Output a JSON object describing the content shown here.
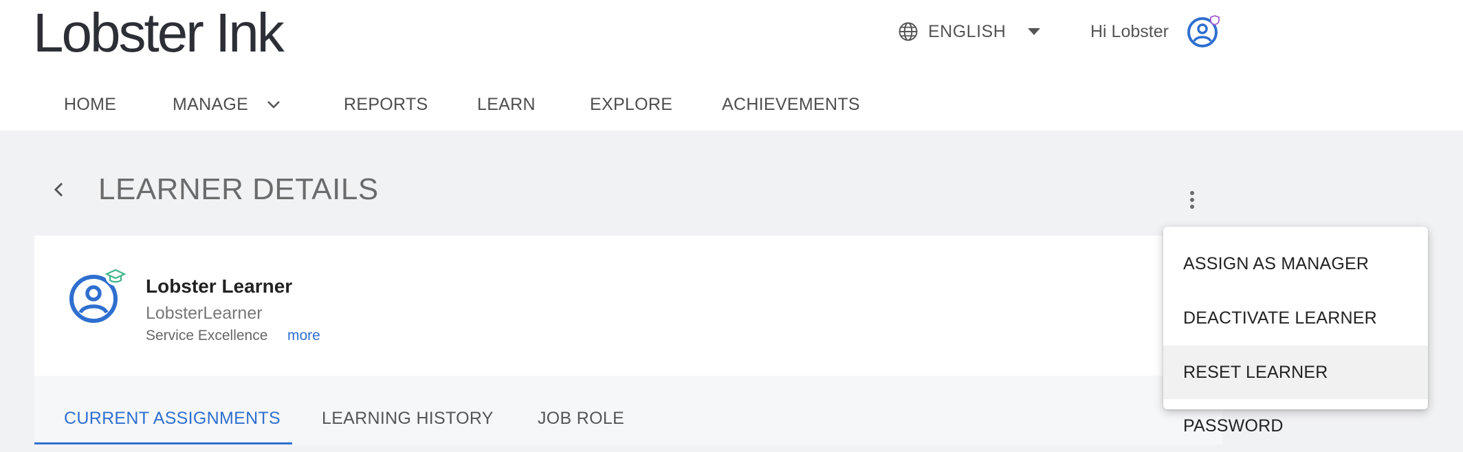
{
  "brand": {
    "logo_text": "Lobster Ink"
  },
  "header": {
    "language_label": "ENGLISH",
    "greeting": "Hi Lobster"
  },
  "nav": {
    "items": [
      "HOME",
      "MANAGE",
      "REPORTS",
      "LEARN",
      "EXPLORE",
      "ACHIEVEMENTS"
    ]
  },
  "page": {
    "title": "LEARNER DETAILS"
  },
  "learner": {
    "name": "Lobster Learner",
    "username": "LobsterLearner",
    "department": "Service Excellence",
    "more_label": "more"
  },
  "tabs": {
    "items": [
      "CURRENT ASSIGNMENTS",
      "LEARNING HISTORY",
      "JOB ROLE"
    ],
    "active": "CURRENT ASSIGNMENTS"
  },
  "menu": {
    "items": [
      "ASSIGN AS MANAGER",
      "DEACTIVATE LEARNER",
      "RESET LEARNER PASSWORD"
    ],
    "highlighted": "RESET LEARNER PASSWORD"
  },
  "colors": {
    "accent": "#2f6fcf",
    "badge_purple": "#a55fd6",
    "badge_green": "#3fb58a",
    "background": "#f1f2f4"
  },
  "icons": {
    "language": "globe-icon",
    "language_dropdown": "caret-down-icon",
    "user": "user-avatar-icon",
    "manage_dropdown": "chevron-down-icon",
    "back": "chevron-left-icon",
    "more_actions": "kebab-menu-icon",
    "learner": "learner-avatar-icon"
  }
}
